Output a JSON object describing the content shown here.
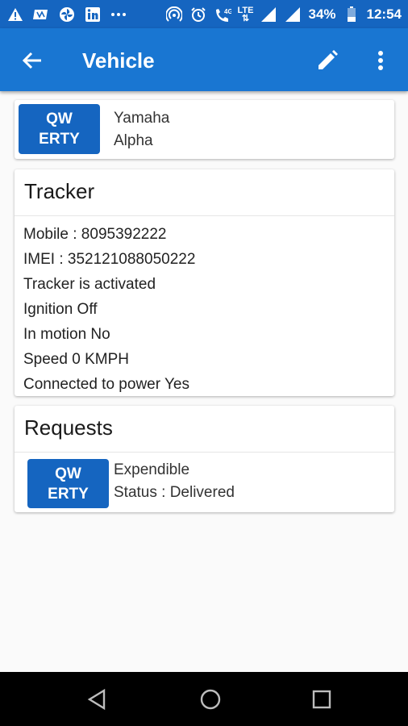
{
  "status_bar": {
    "battery": "34%",
    "time": "12:54",
    "network": "4G",
    "lte": "LTE",
    "icons": [
      "warning-icon",
      "notification-icon",
      "fan-icon",
      "linkedin-icon",
      "more-dots-icon",
      "hotspot-icon",
      "alarm-icon",
      "wifi-calling-icon",
      "signal-icon",
      "signal-icon",
      "battery-icon"
    ]
  },
  "app_bar": {
    "title": "Vehicle",
    "background": "#1976d2"
  },
  "vehicle": {
    "badge": {
      "line1": "QW",
      "line2": "ERTY"
    },
    "make": "Yamaha",
    "model": "Alpha"
  },
  "tracker": {
    "title": "Tracker",
    "lines": [
      "Mobile : 8095392222",
      "IMEI : 352121088050222",
      "Tracker is activated",
      "Ignition Off",
      "In motion No",
      "Speed 0 KMPH",
      "Connected to power Yes"
    ]
  },
  "requests": {
    "title": "Requests",
    "items": [
      {
        "badge": {
          "line1": "QW",
          "line2": "ERTY"
        },
        "type": "Expendible",
        "status": "Status : Delivered"
      }
    ]
  },
  "colors": {
    "status_bar": "#1565c0",
    "app_bar": "#1976d2",
    "badge": "#1565c0"
  }
}
